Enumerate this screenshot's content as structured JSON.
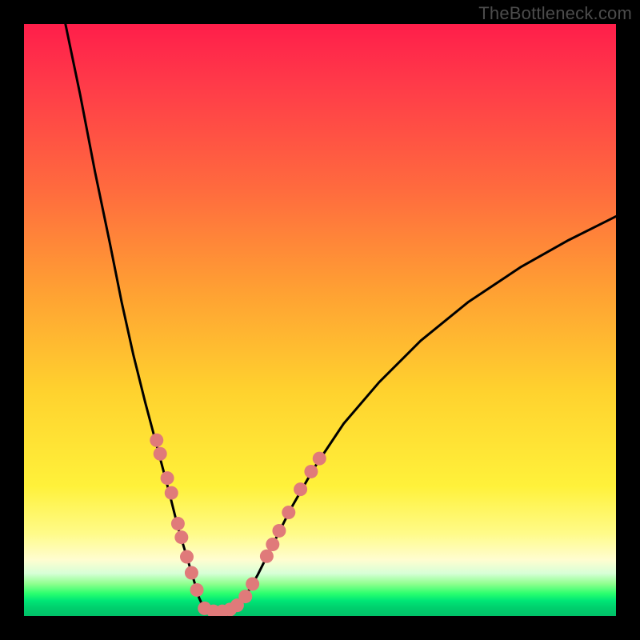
{
  "watermark": "TheBottleneck.com",
  "chart_data": {
    "type": "line",
    "title": "",
    "xlabel": "",
    "ylabel": "",
    "xlim": [
      0,
      100
    ],
    "ylim": [
      0,
      100
    ],
    "grid": false,
    "legend": "none",
    "series": [
      {
        "name": "left-branch",
        "x": [
          7.0,
          9.5,
          12.0,
          14.5,
          16.5,
          18.5,
          20.5,
          22.5,
          24.5,
          26.0,
          27.5,
          28.7,
          29.6,
          30.3
        ],
        "y": [
          100.0,
          88.0,
          75.0,
          63.0,
          53.0,
          44.0,
          36.0,
          28.5,
          21.0,
          15.0,
          10.0,
          6.0,
          3.0,
          1.5
        ]
      },
      {
        "name": "valley",
        "x": [
          30.3,
          31.5,
          33.0,
          34.5,
          35.8
        ],
        "y": [
          1.5,
          0.9,
          0.7,
          0.9,
          1.5
        ]
      },
      {
        "name": "right-branch",
        "x": [
          35.8,
          37.5,
          39.5,
          42.0,
          45.0,
          49.0,
          54.0,
          60.0,
          67.0,
          75.0,
          84.0,
          92.0,
          100.0
        ],
        "y": [
          1.5,
          3.5,
          7.0,
          12.0,
          18.0,
          25.0,
          32.5,
          39.5,
          46.5,
          53.0,
          59.0,
          63.5,
          67.5
        ]
      }
    ],
    "markers": [
      {
        "name": "dots-left",
        "color": "#e07a7a",
        "points": [
          {
            "x": 22.4,
            "y": 29.7
          },
          {
            "x": 23.0,
            "y": 27.4
          },
          {
            "x": 24.2,
            "y": 23.3
          },
          {
            "x": 24.9,
            "y": 20.8
          },
          {
            "x": 26.0,
            "y": 15.6
          },
          {
            "x": 26.6,
            "y": 13.3
          },
          {
            "x": 27.5,
            "y": 10.0
          },
          {
            "x": 28.3,
            "y": 7.3
          },
          {
            "x": 29.2,
            "y": 4.4
          }
        ]
      },
      {
        "name": "dots-valley",
        "color": "#e07a7a",
        "points": [
          {
            "x": 30.5,
            "y": 1.3
          },
          {
            "x": 32.0,
            "y": 0.8
          },
          {
            "x": 33.5,
            "y": 0.8
          },
          {
            "x": 34.8,
            "y": 1.1
          },
          {
            "x": 36.0,
            "y": 1.8
          }
        ]
      },
      {
        "name": "dots-right",
        "color": "#e07a7a",
        "points": [
          {
            "x": 37.4,
            "y": 3.3
          },
          {
            "x": 38.6,
            "y": 5.4
          },
          {
            "x": 41.0,
            "y": 10.1
          },
          {
            "x": 42.0,
            "y": 12.1
          },
          {
            "x": 43.1,
            "y": 14.4
          },
          {
            "x": 44.7,
            "y": 17.5
          },
          {
            "x": 46.7,
            "y": 21.4
          },
          {
            "x": 48.5,
            "y": 24.4
          },
          {
            "x": 49.9,
            "y": 26.6
          }
        ]
      }
    ],
    "background_gradient": {
      "top": "#ff1e4a",
      "mid": "#ffe23a",
      "bottom": "#00c168"
    }
  }
}
